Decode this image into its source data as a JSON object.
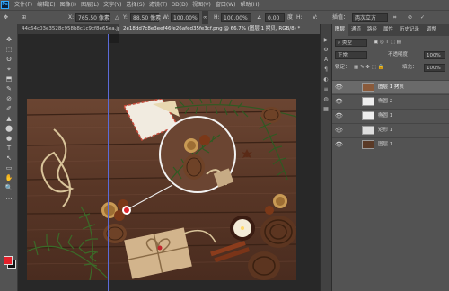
{
  "menu": {
    "logo": "Ps",
    "items": [
      "文件(F)",
      "编辑(E)",
      "图像(I)",
      "图层(L)",
      "文字(Y)",
      "选择(S)",
      "滤镜(T)",
      "3D(D)",
      "视图(V)",
      "窗口(W)",
      "帮助(H)"
    ]
  },
  "options": {
    "x_label": "X:",
    "x_value": "765.50 像素",
    "y_label": "Y:",
    "y_value": "88.50 像素",
    "w_label": "W:",
    "w_value": "100.00%",
    "h_label": "H:",
    "h_value": "100.00%",
    "angle_value": "0.00",
    "interp_label": "插值：",
    "interp_value": "两次立方"
  },
  "doc_tabs": [
    {
      "label": "44c64c03e3528c958b8c1c9cf8e65ea.jpg",
      "close": "×"
    },
    {
      "label": "2e18dd7c8e3eef46fe26afed35fe3cf.png @ 66.7% (图层 1 拷贝, RGB/8) *",
      "close": "×"
    }
  ],
  "tools": [
    "✥",
    "⬚",
    "ʘ",
    "⌖",
    "⬒",
    "✎",
    "⊘",
    "✐",
    "▲",
    "⬤",
    "●",
    "T",
    "↖",
    "▭",
    "✋",
    "🔍",
    "…"
  ],
  "colors": {
    "foreground": "#e3202a",
    "background": "#111111",
    "guide": "#5b6bd8"
  },
  "side_icons": [
    "▶",
    "⚙",
    "A",
    "¶",
    "◐",
    "≡",
    "◍",
    "▦"
  ],
  "panel": {
    "tabs": [
      "图层",
      "通道",
      "路径",
      "属性",
      "历史记录",
      "调整"
    ],
    "filter_label": "类型",
    "blend_mode": "正常",
    "opacity_label": "不透明度：",
    "opacity_value": "100%",
    "lock_label": "锁定：",
    "fill_label": "填充：",
    "fill_value": "100%",
    "layers": [
      {
        "name": "图层 1 拷贝",
        "visible": true,
        "selected": true
      },
      {
        "name": "椭圆 2",
        "visible": true,
        "selected": false
      },
      {
        "name": "椭圆 1",
        "visible": true,
        "selected": false
      },
      {
        "name": "矩形 1",
        "visible": true,
        "selected": false
      },
      {
        "name": "图层 1",
        "visible": true,
        "selected": false
      }
    ]
  }
}
